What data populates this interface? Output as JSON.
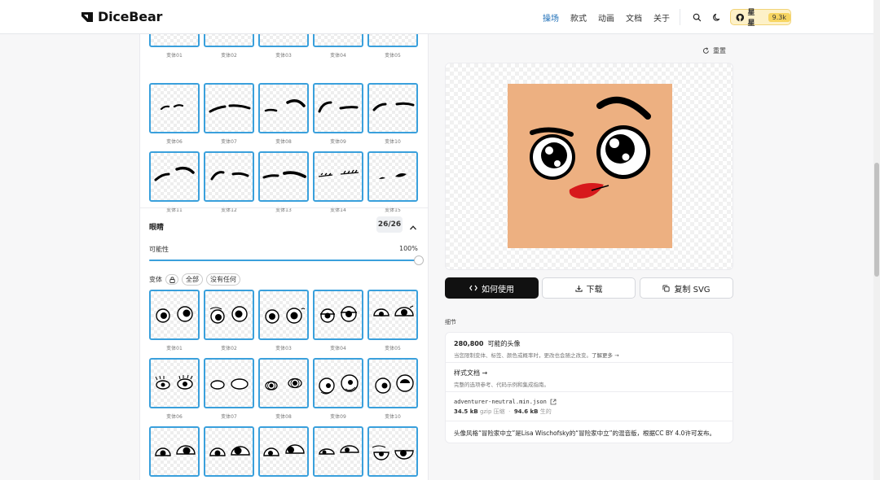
{
  "app": {
    "name": "DiceBear"
  },
  "nav": {
    "items": [
      "操场",
      "款式",
      "动画",
      "文档",
      "关于"
    ],
    "active_index": 0
  },
  "header": {
    "star_label": "星星",
    "star_count": "9.3k"
  },
  "grid_top": {
    "labels": [
      "变体01",
      "变体02",
      "变体03",
      "变体04",
      "变体05",
      "变体06",
      "变体07",
      "变体08",
      "变体09",
      "变体10",
      "变体11",
      "变体12",
      "变体13",
      "变体14",
      "变体15"
    ]
  },
  "eyes_section": {
    "title": "眼睛",
    "count": "26/26",
    "probability_label": "可能性",
    "probability_value": "100%",
    "probability": 1.0,
    "variant_label": "变体",
    "all_chip": "全部",
    "none_chip": "没有任何",
    "labels": [
      "变体01",
      "变体02",
      "变体03",
      "变体04",
      "变体05",
      "变体06",
      "变体07",
      "变体08",
      "变体09",
      "变体10",
      "",
      "",
      "",
      "",
      ""
    ]
  },
  "right": {
    "reset_label": "重置",
    "buttons": {
      "how_to_use": "如何使用",
      "download": "下载",
      "copy_svg": "复制 SVG"
    },
    "details_label": "细节",
    "possible_count": "280,800",
    "possible_label": "可能的头像",
    "possible_note": "当您限制变体、标签、颜色或概率时，更改也会随之改变。",
    "learn_more": "了解更多 →",
    "style_docs": "样式文档 →",
    "style_docs_note": "完整的选项参考、代码示例和集成指南。",
    "file_name": "adventurer-neutral.min.json",
    "gzip_size": "34.5 kB",
    "gzip_label": "gzip 压缩",
    "raw_size": "94.6 kB",
    "raw_label": "生的",
    "license": "头像风格“冒险家中立”是Lisa Wischofsky的“冒险家中立”的混音版，根据CC BY 4.0许可发布。"
  },
  "colors": {
    "accent": "#3aa0dc",
    "avatar_bg": "#edb081",
    "lips": "#d7191c",
    "star_bg": "#fdf1c8"
  }
}
